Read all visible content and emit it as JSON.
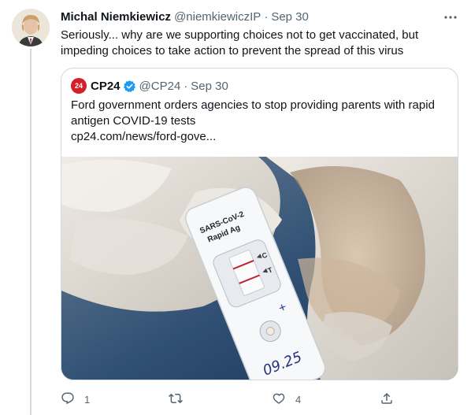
{
  "tweet": {
    "author_name": "Michal Niemkiewicz",
    "author_handle": "@niemkiewiczIP",
    "separator": "·",
    "date": "Sep 30",
    "text": "Seriously...  why are we supporting choices not to get vaccinated, but impeding choices to take action to prevent the spread of this virus"
  },
  "quote": {
    "logo_text": "24",
    "author_name": "CP24",
    "author_handle": "@CP24",
    "separator": "·",
    "date": "Sep 30",
    "text": "Ford government orders agencies to stop providing parents with rapid antigen COVID-19 tests",
    "link": "cp24.com/news/ford-gove...",
    "image": {
      "cassette_label_1": "SARS-CoV-2",
      "cassette_label_2": "Rapid Ag",
      "marker_c": "C",
      "marker_t": "T",
      "plus": "+",
      "handwriting": "09.25"
    }
  },
  "actions": {
    "reply_icon": "reply-icon",
    "reply_count": "1",
    "retweet_icon": "retweet-icon",
    "like_icon": "like-icon",
    "like_count": "4",
    "share_icon": "share-icon"
  },
  "colors": {
    "text": "#0f1419",
    "secondary": "#536471",
    "border": "#cfd9de",
    "verified": "#1d9bf0",
    "cp24_red": "#d3202b"
  }
}
